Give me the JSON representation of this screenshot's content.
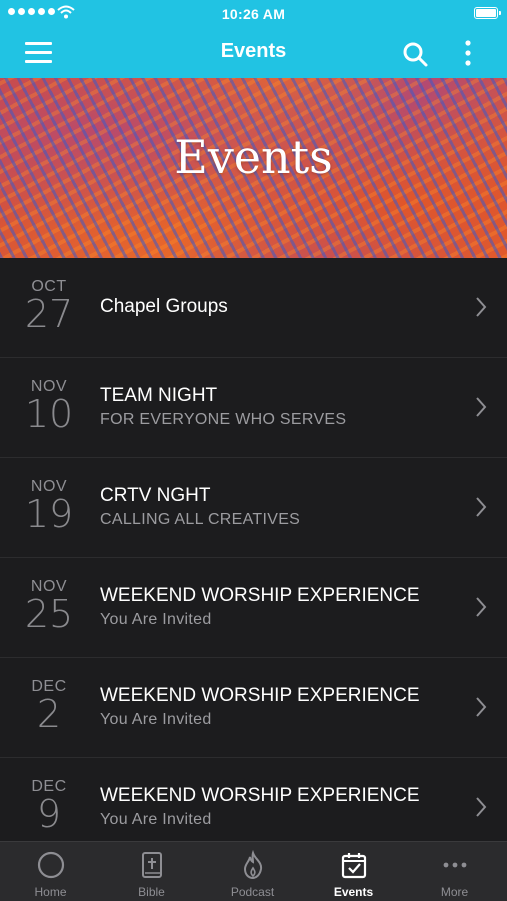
{
  "status_bar": {
    "time": "10:26 AM"
  },
  "nav": {
    "title": "Events"
  },
  "hero": {
    "title": "Events"
  },
  "events": [
    {
      "month": "OCT",
      "day": "27",
      "title": "Chapel Groups",
      "subtitle": ""
    },
    {
      "month": "NOV",
      "day": "10",
      "title": "TEAM NIGHT",
      "subtitle": "FOR EVERYONE WHO SERVES"
    },
    {
      "month": "NOV",
      "day": "19",
      "title": "CRTV NGHT",
      "subtitle": "CALLING ALL CREATIVES"
    },
    {
      "month": "NOV",
      "day": "25",
      "title": "WEEKEND WORSHIP EXPERIENCE",
      "subtitle": "You Are Invited"
    },
    {
      "month": "DEC",
      "day": "2",
      "title": "WEEKEND WORSHIP EXPERIENCE",
      "subtitle": "You Are Invited"
    },
    {
      "month": "DEC",
      "day": "9",
      "title": "WEEKEND WORSHIP EXPERIENCE",
      "subtitle": "You Are Invited"
    }
  ],
  "tabs": [
    {
      "label": "Home",
      "icon": "home-circle-icon"
    },
    {
      "label": "Bible",
      "icon": "bible-icon"
    },
    {
      "label": "Podcast",
      "icon": "flame-icon"
    },
    {
      "label": "Events",
      "icon": "calendar-check-icon"
    },
    {
      "label": "More",
      "icon": "more-dots-icon"
    }
  ],
  "colors": {
    "accent": "#21c3e3",
    "background": "#1c1c1e",
    "tab_bar": "#2b2b2d"
  }
}
